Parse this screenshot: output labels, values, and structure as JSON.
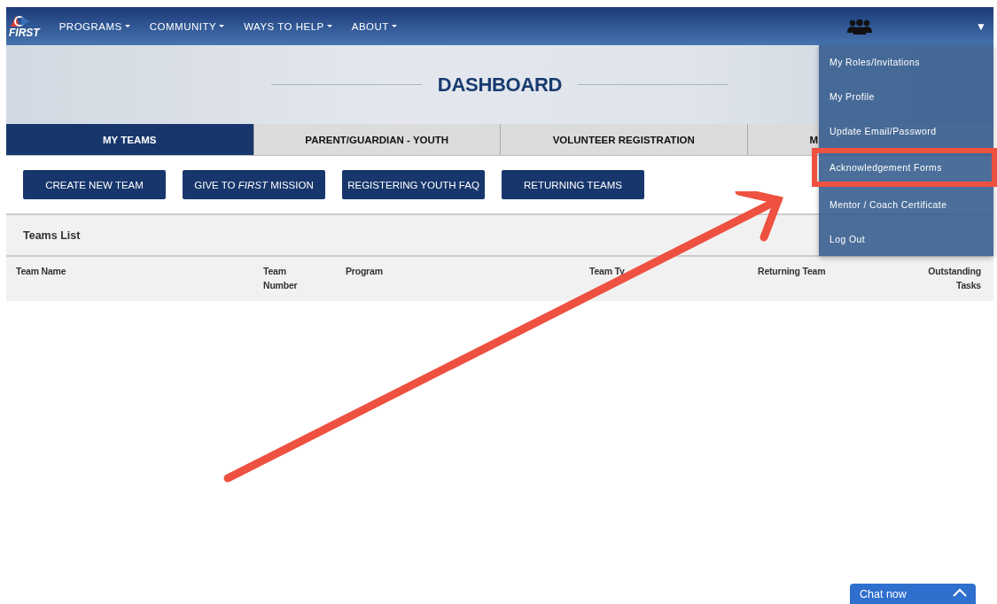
{
  "navbar": {
    "logo_text": "FIRST",
    "menu": [
      {
        "label": "PROGRAMS"
      },
      {
        "label": "COMMUNITY"
      },
      {
        "label": "WAYS TO HELP"
      },
      {
        "label": "ABOUT"
      }
    ],
    "account_caret": "▼"
  },
  "account_menu": [
    {
      "label": "My Roles/Invitations",
      "highlighted": false
    },
    {
      "label": "My Profile",
      "highlighted": false
    },
    {
      "label": "Update Email/Password",
      "highlighted": false
    },
    {
      "label": "Acknowledgement Forms",
      "highlighted": true
    },
    {
      "label": "Mentor / Coach Certificate",
      "highlighted": false
    },
    {
      "label": "Log Out",
      "highlighted": false
    }
  ],
  "hero": {
    "title": "DASHBOARD"
  },
  "tabs": [
    {
      "label": "MY TEAMS",
      "selected": true
    },
    {
      "label": "PARENT/GUARDIAN - YOUTH",
      "selected": false
    },
    {
      "label": "VOLUNTEER REGISTRATION",
      "selected": false
    },
    {
      "label": "M",
      "selected": false
    }
  ],
  "actions": [
    "CREATE NEW TEAM",
    "GIVE TO *FIRST* MISSION",
    "REGISTERING YOUTH FAQ",
    "RETURNING TEAMS"
  ],
  "teams_list": {
    "title": "Teams List",
    "columns": [
      "Team Name",
      "Team Number",
      "Program",
      "Team Ty",
      "Returning Team",
      "Outstanding Tasks"
    ]
  },
  "chat": {
    "label": "Chat now"
  }
}
